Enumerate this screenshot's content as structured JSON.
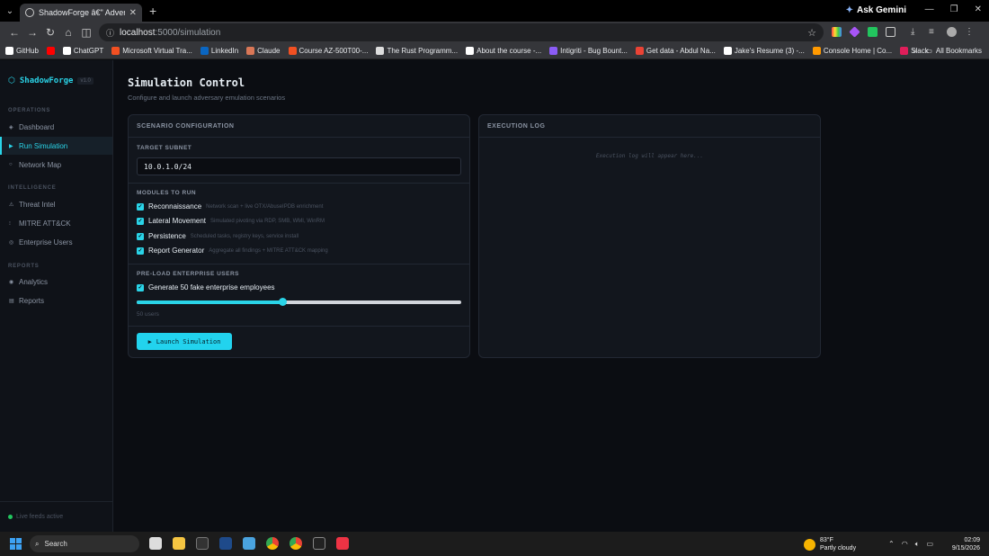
{
  "browser": {
    "tab_title": "ShadowForge â€\" Adversary Em",
    "url_host": "localhost",
    "url_path": ":5000/simulation",
    "ask_gemini": "Ask Gemini",
    "bookmarks": [
      {
        "label": "GitHub",
        "color": "#ffffff"
      },
      {
        "label": "",
        "color": "#ff0000"
      },
      {
        "label": "ChatGPT",
        "color": "#ffffff"
      },
      {
        "label": "Microsoft Virtual Tra...",
        "color": "#f25022"
      },
      {
        "label": "LinkedIn",
        "color": "#0a66c2"
      },
      {
        "label": "Claude",
        "color": "#d97757"
      },
      {
        "label": "Course AZ-500T00-...",
        "color": "#f25022"
      },
      {
        "label": "The Rust Programm...",
        "color": "#dddddd"
      },
      {
        "label": "About the course -...",
        "color": "#ffffff"
      },
      {
        "label": "Intigriti - Bug Bount...",
        "color": "#8b5cf6"
      },
      {
        "label": "Get data - Abdul Na...",
        "color": "#ea4335"
      },
      {
        "label": "Jake's Resume (3) -...",
        "color": "#ffffff"
      },
      {
        "label": "Console Home | Co...",
        "color": "#ff9900"
      },
      {
        "label": "Slack",
        "color": "#e01e5a"
      }
    ],
    "bookmarks_more": "»",
    "all_bookmarks": "All Bookmarks"
  },
  "sidebar": {
    "brand": "ShadowForge",
    "version": "v1.0",
    "sections": [
      {
        "label": "OPERATIONS"
      },
      {
        "label": "INTELLIGENCE"
      },
      {
        "label": "REPORTS"
      }
    ],
    "items": [
      {
        "label": "Dashboard",
        "icon": "◈"
      },
      {
        "label": "Run Simulation",
        "icon": "▶"
      },
      {
        "label": "Network Map",
        "icon": "○"
      },
      {
        "label": "Threat Intel",
        "icon": "⚠"
      },
      {
        "label": "MITRE ATT&CK",
        "icon": "⁝"
      },
      {
        "label": "Enterprise Users",
        "icon": "◎"
      },
      {
        "label": "Analytics",
        "icon": "◉"
      },
      {
        "label": "Reports",
        "icon": "▤"
      }
    ],
    "footer": "Live feeds active"
  },
  "main": {
    "title": "Simulation Control",
    "subtitle": "Configure and launch adversary emulation scenarios",
    "config": {
      "heading": "SCENARIO CONFIGURATION",
      "subnet_label": "TARGET SUBNET",
      "subnet_value": "10.0.1.0/24",
      "modules_label": "MODULES TO RUN",
      "modules": [
        {
          "name": "Reconnaissance",
          "desc": "Network scan + live OTX/AbuseIPDB enrichment",
          "checked": true
        },
        {
          "name": "Lateral Movement",
          "desc": "Simulated pivoting via RDP, SMB, WMI, WinRM",
          "checked": true
        },
        {
          "name": "Persistence",
          "desc": "Scheduled tasks, registry keys, service install",
          "checked": true
        },
        {
          "name": "Report Generator",
          "desc": "Aggregate all findings + MITRE ATT&CK mapping",
          "checked": true
        }
      ],
      "preload_label": "PRE-LOAD ENTERPRISE USERS",
      "preload_check": "Generate 50 fake enterprise employees",
      "slider_fraction": 0.45,
      "slider_caption": "50 users",
      "launch_label": "Launch Simulation"
    },
    "log": {
      "heading": "EXECUTION LOG",
      "empty": "Execution log will appear here..."
    }
  },
  "taskbar": {
    "search": "Search",
    "weather_temp": "83°F",
    "weather_desc": "Partly cloudy",
    "time": "02:09",
    "date": "9/15/2026"
  }
}
